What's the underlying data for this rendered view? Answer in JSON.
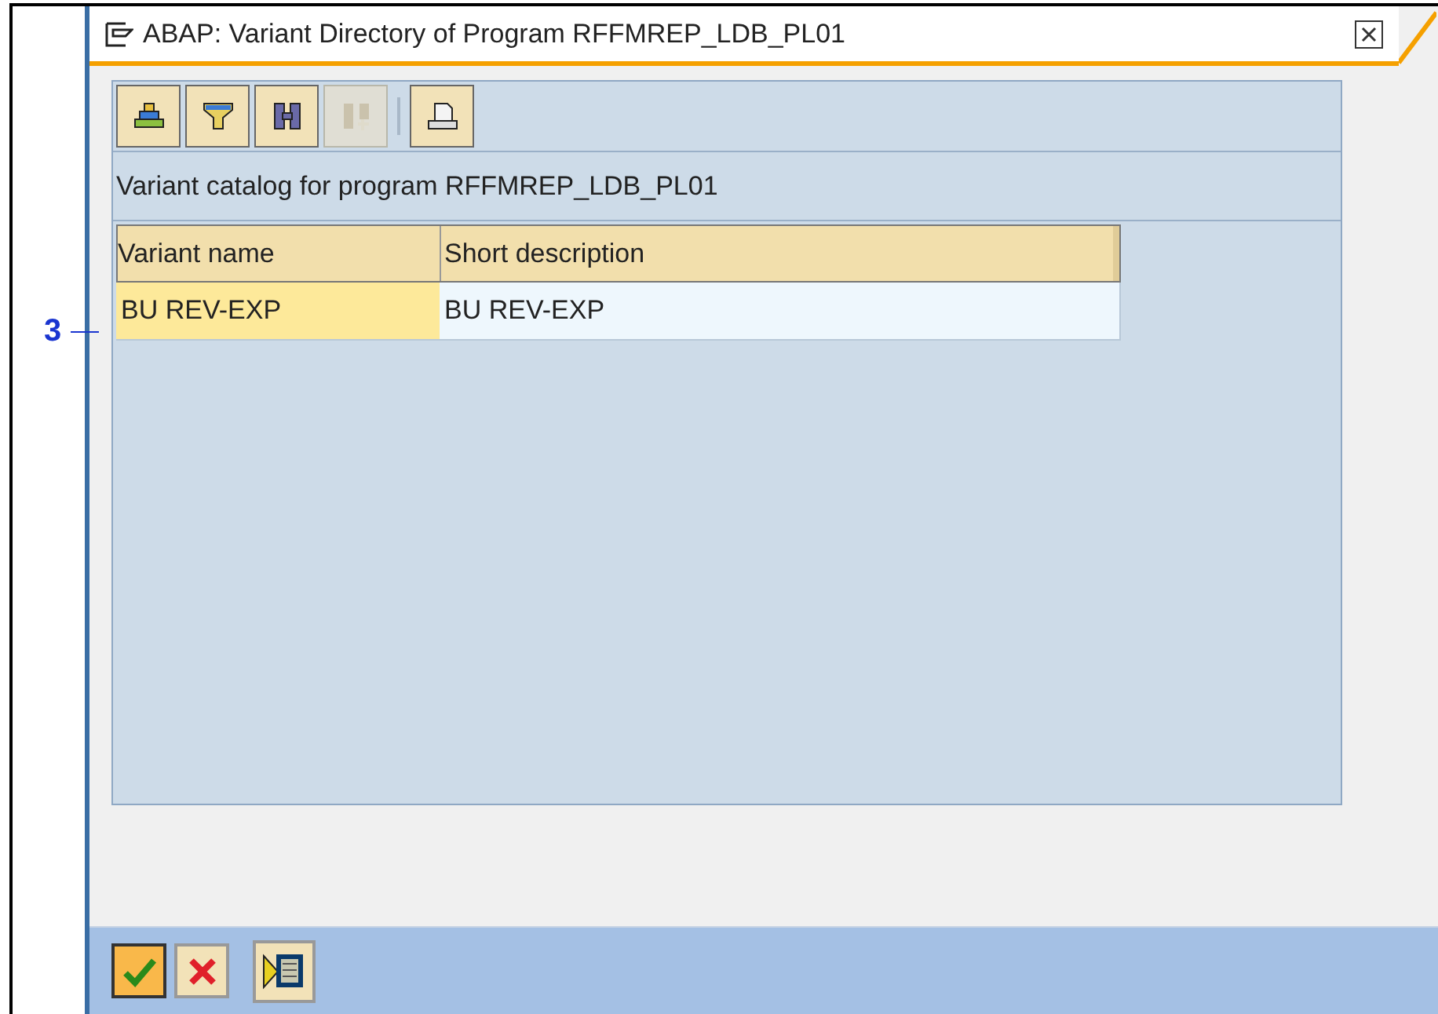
{
  "annotation": "3",
  "window": {
    "title": "ABAP: Variant Directory of Program RFFMREP_LDB_PL01"
  },
  "toolbar": [
    [
      {
        "kind": "stack",
        "disabled": false
      },
      {
        "kind": "filter",
        "disabled": false
      },
      {
        "kind": "find",
        "disabled": false
      },
      {
        "kind": "find-next",
        "disabled": true
      }
    ],
    [
      {
        "kind": "print",
        "disabled": false
      }
    ]
  ],
  "caption": "Variant catalog for program RFFMREP_LDB_PL01",
  "table": {
    "columns": [
      "Variant name",
      "Short description"
    ],
    "rows": [
      [
        "BU REV-EXP",
        "BU REV-EXP"
      ]
    ]
  },
  "footer_buttons": [
    {
      "kind": "confirm",
      "default": true
    },
    {
      "kind": "cancel",
      "default": false
    },
    {
      "kind": "execute",
      "default": false
    }
  ]
}
